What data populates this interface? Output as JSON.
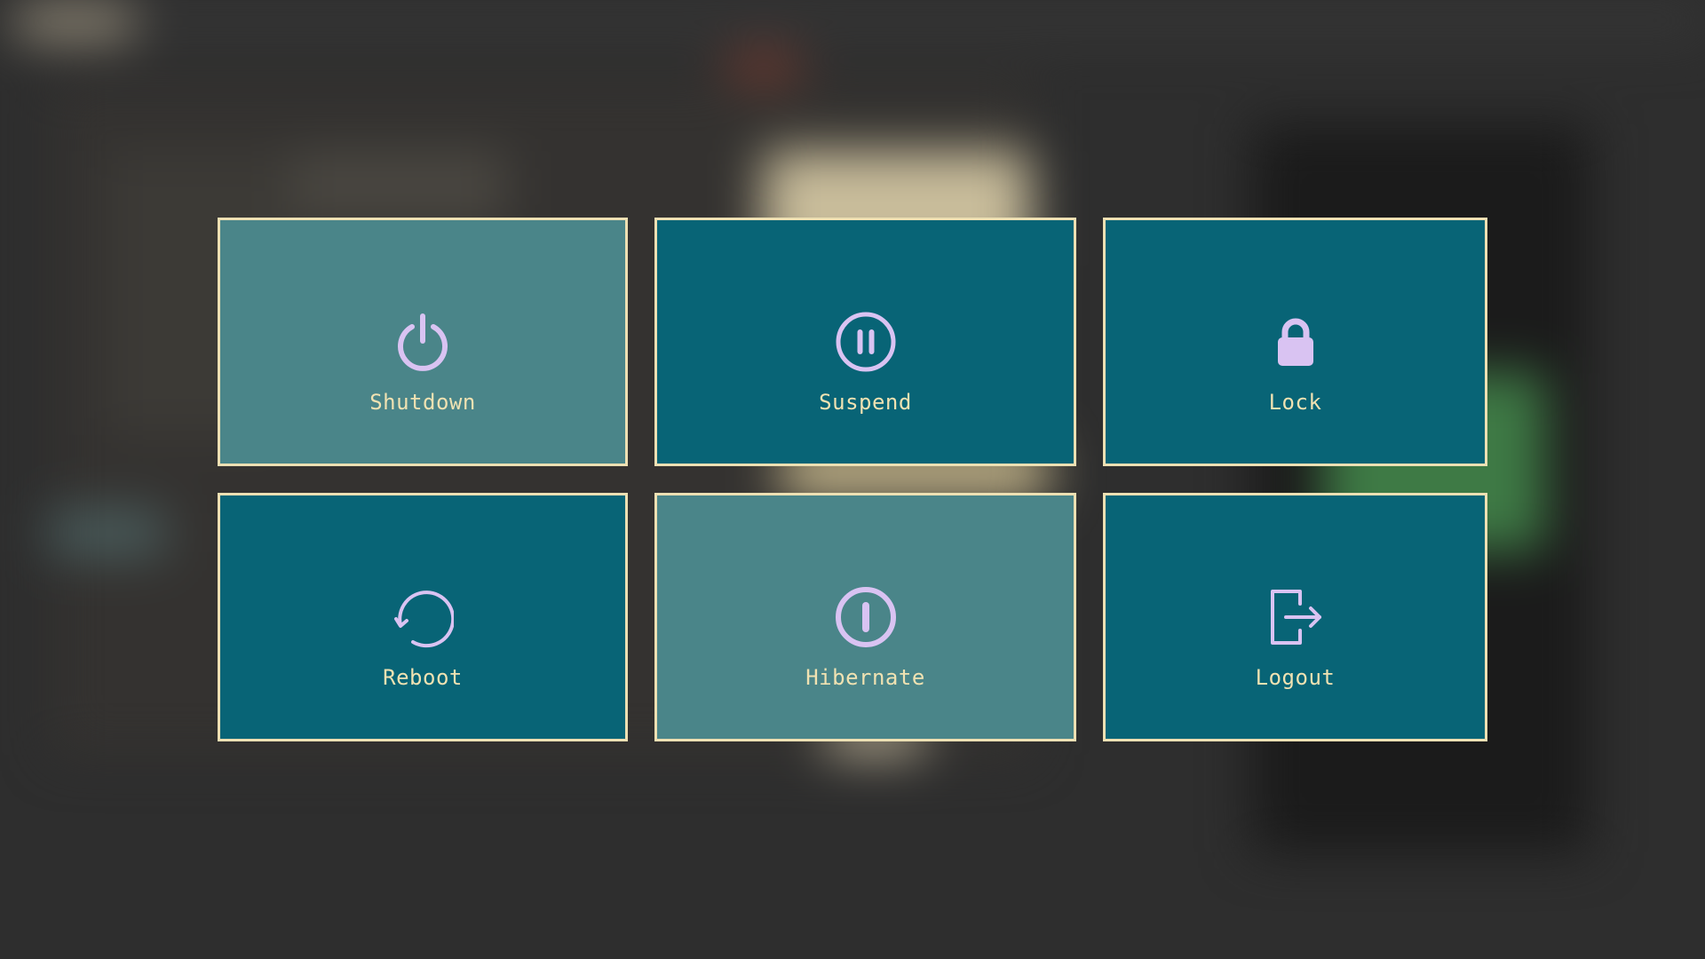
{
  "colors": {
    "tile_background": "#086476",
    "tile_selected_background": "#4a8589",
    "tile_border": "#ede0b3",
    "label_text": "#f0e2b2",
    "icon": "#d9c3f2"
  },
  "actions": [
    {
      "label": "Shutdown",
      "icon": "power-icon",
      "selected": true
    },
    {
      "label": "Suspend",
      "icon": "pause-circle-icon",
      "selected": false
    },
    {
      "label": "Lock",
      "icon": "lock-icon",
      "selected": false
    },
    {
      "label": "Reboot",
      "icon": "reboot-icon",
      "selected": false
    },
    {
      "label": "Hibernate",
      "icon": "hibernate-icon",
      "selected": true
    },
    {
      "label": "Logout",
      "icon": "logout-icon",
      "selected": false
    }
  ]
}
